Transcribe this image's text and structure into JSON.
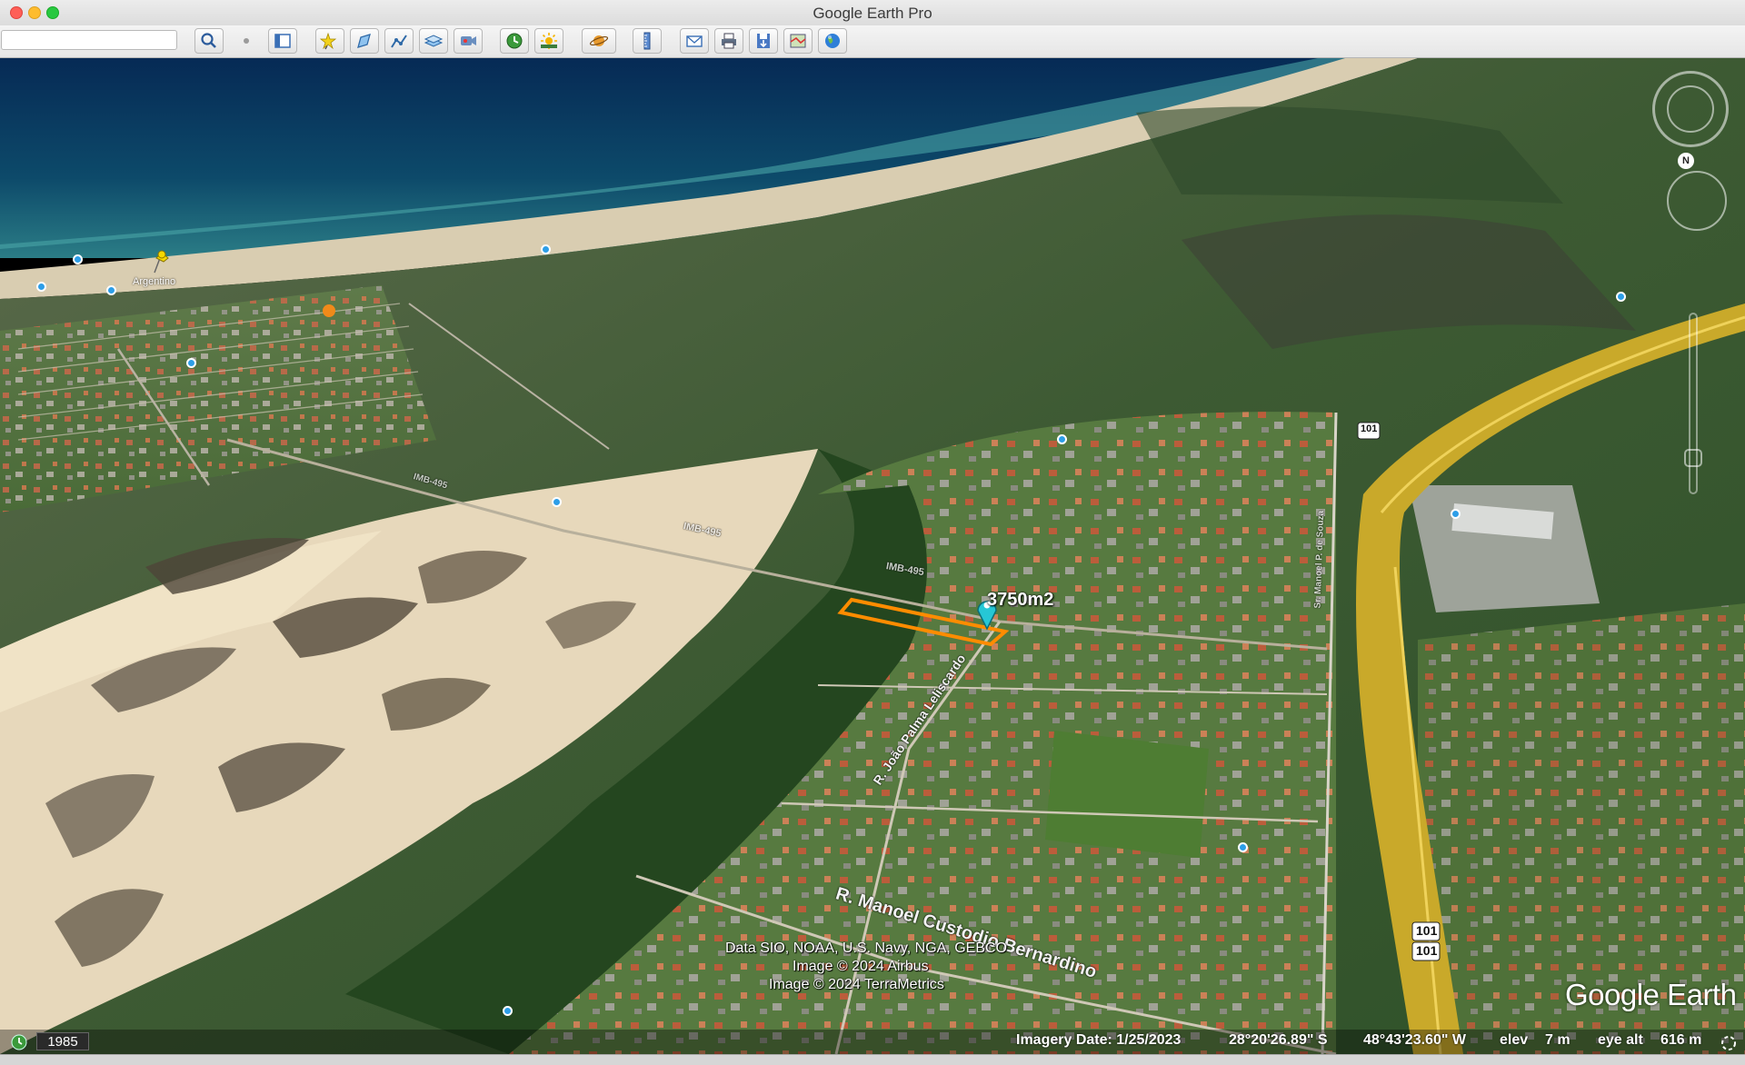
{
  "window": {
    "title": "Google Earth Pro"
  },
  "toolbar": {
    "search_placeholder": "",
    "buttons": [
      "search-icon",
      "sidebar-toggle-icon",
      "add-placemark-icon",
      "add-polygon-icon",
      "add-path-icon",
      "add-image-overlay-icon",
      "record-tour-icon",
      "historical-imagery-icon",
      "sunlight-icon",
      "switch-planet-icon",
      "ruler-icon",
      "email-icon",
      "print-icon",
      "save-image-icon",
      "view-in-maps-icon",
      "earth-icon"
    ]
  },
  "map": {
    "placemark_argentino": "Argentino",
    "polygon_label": "3750m2",
    "polygon_color": "#ff8c00",
    "roads": {
      "r1": "R. Manoel Custodio Bernardino",
      "r2": "R. João Palma Leliscardo",
      "r3": "IMB-495",
      "r4": "IMB-495",
      "r5": "IMB-495",
      "r6": "Sr. Manoel P. de Souza",
      "shield_1": "101",
      "shield_2": "101",
      "shield_3": "101"
    },
    "attribution": {
      "line1": "Data SIO, NOAA, U.S. Navy, NGA, GEBCO",
      "line2": "Image © 2024 Airbus",
      "line3": "Image © 2024 TerraMetrics"
    },
    "logo": "Google Earth",
    "compass_north": "N"
  },
  "status": {
    "year": "1985",
    "imagery_date": "Imagery Date: 1/25/2023",
    "lat": "28°20'26.89\" S",
    "lon": "48°43'23.60\" W",
    "elev_label": "elev",
    "elev_value": "7 m",
    "eye_alt_label": "eye alt",
    "eye_alt_value": "616 m"
  }
}
